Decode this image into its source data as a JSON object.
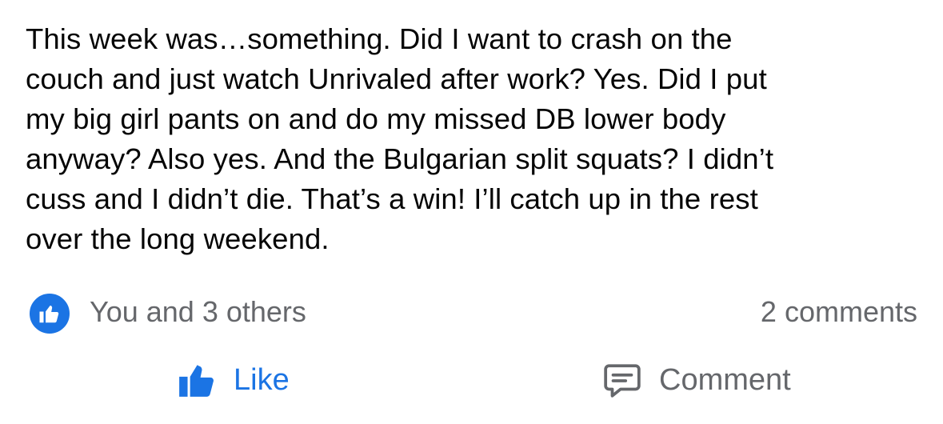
{
  "post": {
    "text_lines": [
      "This week was…something. Did I want to crash on the",
      "couch and just watch Unrivaled after work? Yes. Did I put",
      "my big girl pants on and do my missed DB lower body",
      "anyway? Also yes. And the Bulgarian split squats? I didn’t",
      "cuss and I didn’t die. That’s a win! I’ll catch up in the rest",
      "over the long weekend."
    ]
  },
  "reactions": {
    "icon": "thumbs-up-icon",
    "text": "You and 3 others",
    "comments_count": "2 comments"
  },
  "actions": {
    "like_label": "Like",
    "like_icon": "thumbs-up-icon",
    "comment_label": "Comment",
    "comment_icon": "comment-bubble-icon"
  },
  "colors": {
    "accent": "#1b74e4",
    "text_primary": "#050505",
    "text_secondary": "#65676b"
  }
}
